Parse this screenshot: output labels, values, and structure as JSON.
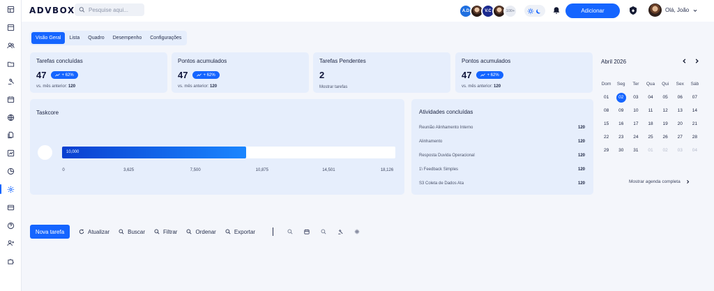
{
  "header": {
    "logo": "ADVBOX",
    "search_placeholder": "Pesquise aqui...",
    "avatars": [
      "A.D",
      "V.C",
      "100+"
    ],
    "add_label": "Adicionar",
    "greeting": "Olá, João"
  },
  "tabs": [
    {
      "label": "Visão Geral",
      "active": true
    },
    {
      "label": "Lista"
    },
    {
      "label": "Quadro"
    },
    {
      "label": "Desempenho"
    },
    {
      "label": "Configurações"
    }
  ],
  "kpis": [
    {
      "title": "Tarefas concluídas",
      "value": "47",
      "badge": "+ 62%",
      "sub_label": "vs. mês anterior:",
      "sub_value": "120"
    },
    {
      "title": "Pontos acumulados",
      "value": "47",
      "badge": "+ 62%",
      "sub_label": "vs. mês anterior:",
      "sub_value": "120"
    },
    {
      "title": "Tarefas Pendentes",
      "value": "2",
      "sub_label": "Mostrar tarefas"
    },
    {
      "title": "Pontos acumulados",
      "value": "47",
      "badge": "+ 62%",
      "sub_label": "vs. mês anterior:",
      "sub_value": "120"
    }
  ],
  "taskcore": {
    "title": "Taskcore",
    "value_label": "10,000",
    "value": 10000,
    "max": 18126,
    "ticks": [
      "0",
      "3,625",
      "7,500",
      "10,875",
      "14,501",
      "18,126"
    ]
  },
  "activities": {
    "title": "Atividades concluídas",
    "items": [
      {
        "name": "Reunião Alinhamento Interno",
        "value": "120"
      },
      {
        "name": "Alinhamento",
        "value": "120"
      },
      {
        "name": "Resposta Duvida Operacional",
        "value": "120"
      },
      {
        "name": "1\\ Feedback Simples",
        "value": "120"
      },
      {
        "name": "S3 Coleta de Dados Ata",
        "value": "120"
      }
    ]
  },
  "calendar": {
    "title": "Abril 2026",
    "weekdays": [
      "Dom",
      "Seg",
      "Ter",
      "Qua",
      "Qui",
      "Sex",
      "Sáb"
    ],
    "days": [
      {
        "d": "01"
      },
      {
        "d": "02",
        "sel": true
      },
      {
        "d": "03"
      },
      {
        "d": "04"
      },
      {
        "d": "05"
      },
      {
        "d": "06"
      },
      {
        "d": "07"
      },
      {
        "d": "08"
      },
      {
        "d": "09"
      },
      {
        "d": "10"
      },
      {
        "d": "11"
      },
      {
        "d": "12"
      },
      {
        "d": "13"
      },
      {
        "d": "14"
      },
      {
        "d": "15"
      },
      {
        "d": "16"
      },
      {
        "d": "17"
      },
      {
        "d": "18"
      },
      {
        "d": "19"
      },
      {
        "d": "20"
      },
      {
        "d": "21"
      },
      {
        "d": "22"
      },
      {
        "d": "23"
      },
      {
        "d": "24"
      },
      {
        "d": "25"
      },
      {
        "d": "26"
      },
      {
        "d": "27"
      },
      {
        "d": "28"
      },
      {
        "d": "29"
      },
      {
        "d": "30"
      },
      {
        "d": "31"
      },
      {
        "d": "01",
        "muted": true
      },
      {
        "d": "02",
        "muted": true
      },
      {
        "d": "03",
        "muted": true
      },
      {
        "d": "04",
        "muted": true
      }
    ],
    "show_full": "Mostrar agenda completa"
  },
  "toolbar": {
    "new_task": "Nova tarefa",
    "refresh": "Atualizar",
    "search": "Buscar",
    "filter": "Filtrar",
    "sort": "Ordenar",
    "export": "Exportar"
  },
  "colors": {
    "accent": "#1565ff",
    "card": "#e6eefc"
  }
}
